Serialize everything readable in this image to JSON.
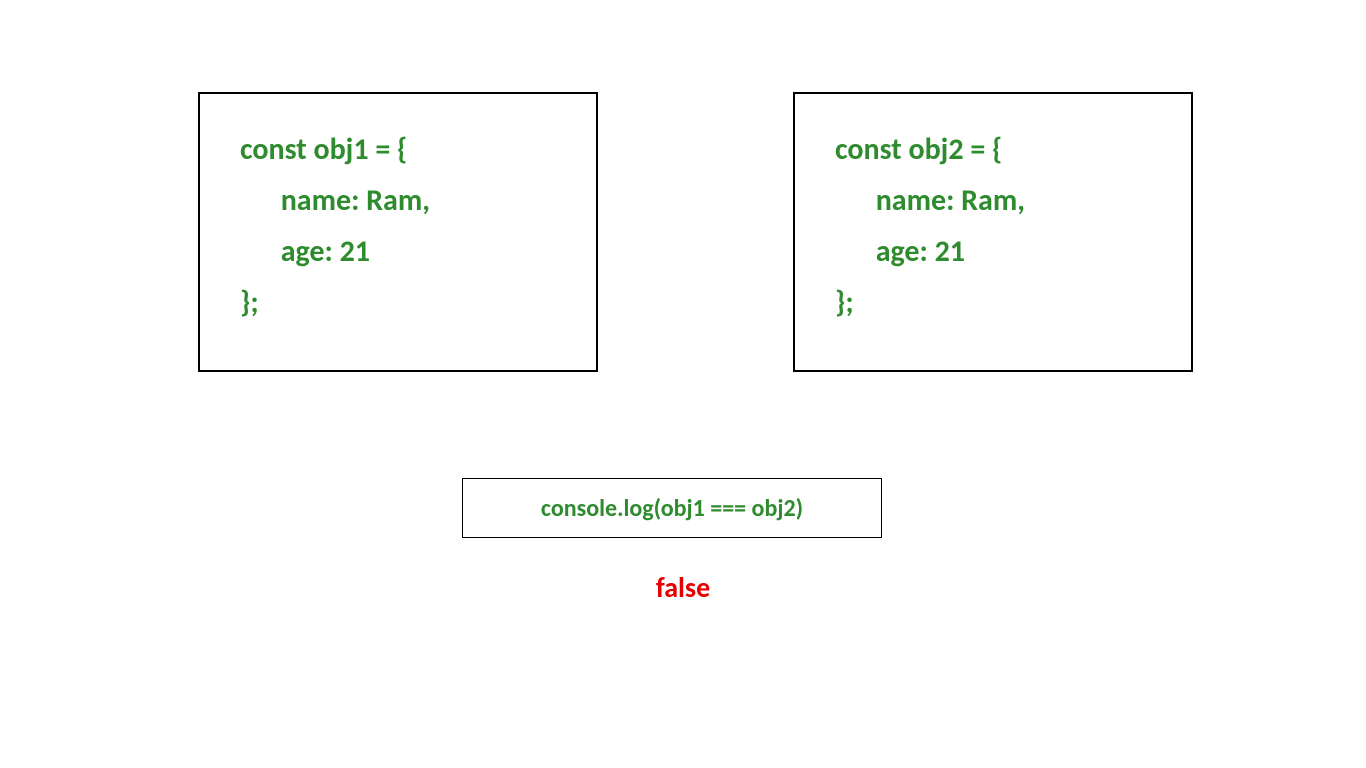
{
  "box1": {
    "line1": "const obj1 = {",
    "line2": "      name: Ram,",
    "line3": "      age: 21",
    "line4": "};"
  },
  "box2": {
    "line1": "const obj2 = {",
    "line2": "      name: Ram,",
    "line3": "      age: 21",
    "line4": "};"
  },
  "console": {
    "text": "console.log(obj1 === obj2)"
  },
  "result": {
    "text": "false"
  }
}
